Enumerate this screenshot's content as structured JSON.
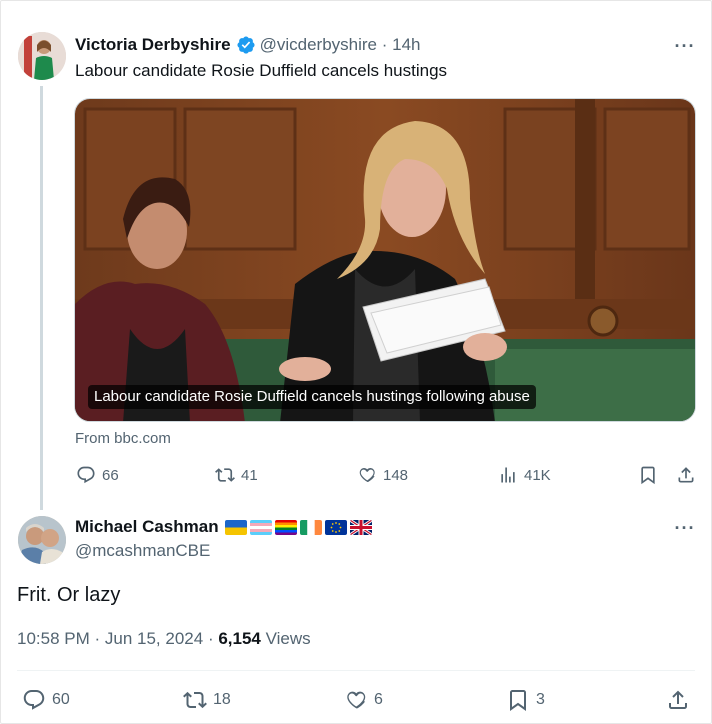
{
  "tweet": {
    "author_name": "Victoria Derbyshire",
    "handle": "@vicderbyshire",
    "time": "14h",
    "text": "Labour candidate Rosie Duffield cancels hustings",
    "card_caption": "Labour candidate Rosie Duffield cancels hustings following abuse",
    "card_source": "From bbc.com",
    "replies": "66",
    "reposts": "41",
    "likes": "148",
    "views": "41K"
  },
  "reply": {
    "author_name": "Michael Cashman",
    "handle": "@mcashmanCBE",
    "flags": [
      "flag-ukraine",
      "flag-trans",
      "flag-rainbow",
      "flag-ireland",
      "flag-eu",
      "flag-uk"
    ],
    "text": "Frit. Or lazy",
    "time": "10:58 PM",
    "date": "Jun 15, 2024",
    "views_count": "6,154",
    "views_label": "Views",
    "replies": "60",
    "reposts": "18",
    "likes": "6",
    "bookmarks": "3"
  },
  "colors": {
    "verified_blue": "#1d9bf0",
    "text_primary": "#0f1419",
    "text_secondary": "#536471"
  }
}
